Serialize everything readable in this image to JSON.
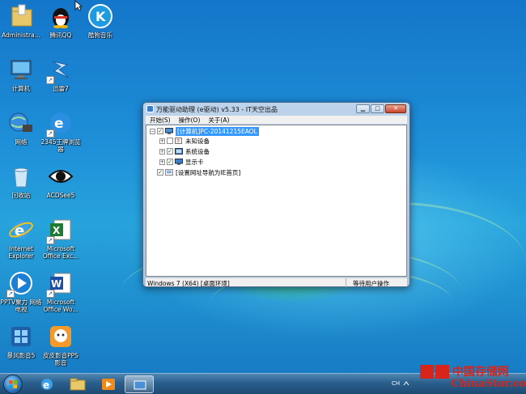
{
  "desktop": {
    "icons": [
      {
        "label": "Administra...",
        "icon": "user-folder-icon"
      },
      {
        "label": "腾讯QQ",
        "icon": "qq-penguin-icon"
      },
      {
        "label": "酷狗音乐",
        "icon": "kugou-music-icon"
      },
      {
        "label": "计算机",
        "icon": "computer-icon"
      },
      {
        "label": "迅雷7",
        "icon": "thunder-icon"
      },
      {
        "label": "网络",
        "icon": "network-icon"
      },
      {
        "label": "2345王牌浏览器",
        "icon": "browser-2345-icon"
      },
      {
        "label": "回收站",
        "icon": "recycle-bin-icon"
      },
      {
        "label": "ACDSee5",
        "icon": "acdsee-eye-icon"
      },
      {
        "label": "Internet Explorer",
        "icon": "internet-explorer-icon"
      },
      {
        "label": "Microsoft Office Exc...",
        "icon": "excel-icon"
      },
      {
        "label": "PPTV聚力 网络电视",
        "icon": "pptv-icon"
      },
      {
        "label": "Microsoft Office Wo...",
        "icon": "word-icon"
      },
      {
        "label": "暴风影音5",
        "icon": "baofeng-icon"
      },
      {
        "label": "皮皮影音PPS 影音",
        "icon": "pps-icon"
      }
    ]
  },
  "window": {
    "title": "万能驱动助理 (e驱动) v5.33 - IT天空出品",
    "menu": [
      "开始(S)",
      "操作(O)",
      "关于(A)"
    ],
    "tree": {
      "root": "[计算机]PC-20141215EAOL",
      "children": [
        "未知设备",
        "系统设备",
        "显示卡"
      ],
      "option": "[设置网址导航为IE首页]"
    },
    "status_left": "Windows 7 (X64) [桌面环境]",
    "status_right": "等待用户操作"
  },
  "taskbar": {
    "tray_text": "CH"
  },
  "watermark": {
    "logo_char": "存储",
    "cn": "中国存储网",
    "en": "ChinaStor.com"
  }
}
